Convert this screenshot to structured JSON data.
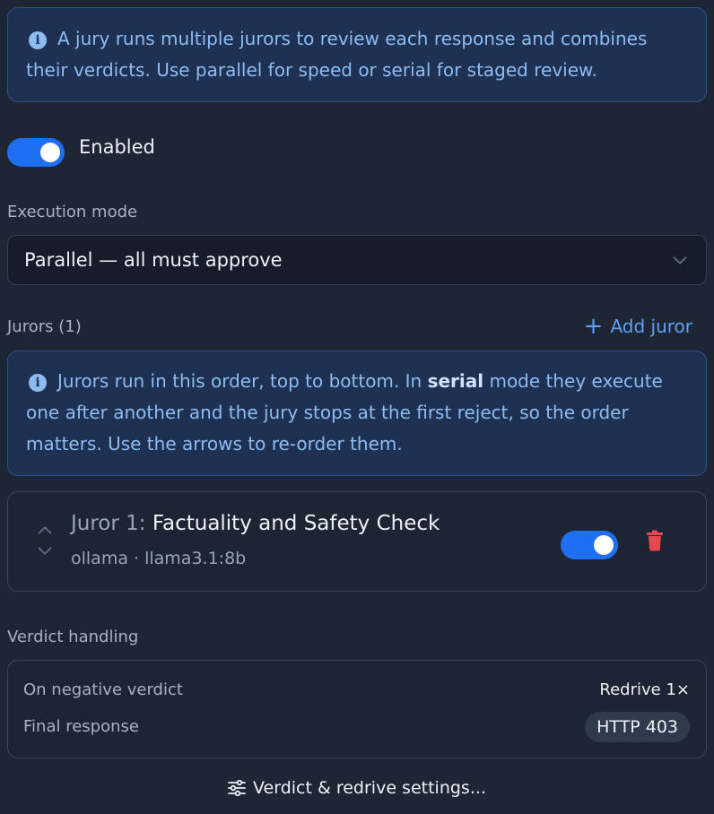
{
  "intro": {
    "text": "A jury runs multiple jurors to review each response and combines their verdicts. Use parallel for speed or serial for staged review."
  },
  "enabled": {
    "label": "Enabled",
    "on": true
  },
  "execution_mode": {
    "label": "Execution mode",
    "value": "Parallel — all must approve"
  },
  "jurors_section": {
    "label": "Jurors (1)",
    "add_label": "Add juror",
    "info_before": "Jurors run in this order, top to bottom. In ",
    "info_bold": "serial",
    "info_after": " mode they execute one after another and the jury stops at the first reject, so the order matters. Use the arrows to re-order them."
  },
  "jurors": [
    {
      "prefix": "Juror 1:",
      "name": "Factuality and Safety Check",
      "provider_model": "ollama · llama3.1:8b",
      "enabled": true
    }
  ],
  "verdict": {
    "label": "Verdict handling",
    "negative_label": "On negative verdict",
    "negative_value": "Redrive 1×",
    "final_label": "Final response",
    "final_value": "HTTP 403"
  },
  "settings_link": "Verdict & redrive settings...",
  "colors": {
    "accent": "#1f6ff2",
    "link": "#5ea0f5",
    "danger": "#e5484d",
    "info_bg": "#1f3152"
  }
}
